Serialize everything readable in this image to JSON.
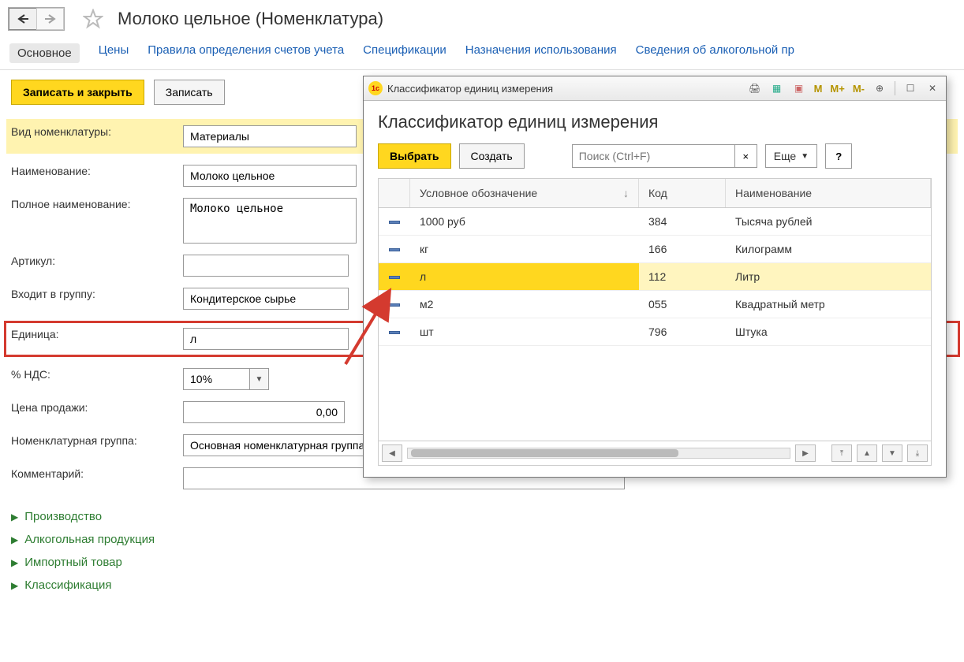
{
  "header": {
    "title": "Молоко цельное (Номенклатура)"
  },
  "tabs": {
    "main": "Основное",
    "prices": "Цены",
    "rules": "Правила определения счетов учета",
    "specs": "Спецификации",
    "usage": "Назначения использования",
    "alcohol": "Сведения об алкогольной пр"
  },
  "toolbar": {
    "save_close": "Записать и закрыть",
    "save": "Записать"
  },
  "form": {
    "type_label": "Вид номенклатуры:",
    "type_value": "Материалы",
    "name_label": "Наименование:",
    "name_value": "Молоко цельное",
    "fullname_label": "Полное наименование:",
    "fullname_value": "Молоко цельное",
    "article_label": "Артикул:",
    "article_value": "",
    "group_label": "Входит в группу:",
    "group_value": "Кондитерское сырье",
    "unit_label": "Единица:",
    "unit_value": "л",
    "vat_label": "% НДС:",
    "vat_value": "10%",
    "price_label": "Цена продажи:",
    "price_value": "0,00",
    "nomgroup_label": "Номенклатурная группа:",
    "nomgroup_value": "Основная номенклатурная группа",
    "comment_label": "Комментарий:",
    "comment_value": ""
  },
  "expand": {
    "production": "Производство",
    "alcohol": "Алкогольная продукция",
    "import": "Импортный товар",
    "classif": "Классификация"
  },
  "dialog": {
    "winTitle": "Классификатор единиц измерения",
    "heading": "Классификатор единиц измерения",
    "select": "Выбрать",
    "create": "Создать",
    "search_ph": "Поиск (Ctrl+F)",
    "more": "Еще",
    "help": "?",
    "cols": {
      "symbol": "Условное обозначение",
      "code": "Код",
      "name": "Наименование"
    },
    "rows": [
      {
        "sym": "1000 руб",
        "code": "384",
        "name": "Тысяча рублей"
      },
      {
        "sym": "кг",
        "code": "166",
        "name": "Килограмм"
      },
      {
        "sym": "л",
        "code": "112",
        "name": "Литр",
        "selected": true
      },
      {
        "sym": "м2",
        "code": "055",
        "name": "Квадратный метр"
      },
      {
        "sym": "шт",
        "code": "796",
        "name": "Штука"
      }
    ]
  }
}
